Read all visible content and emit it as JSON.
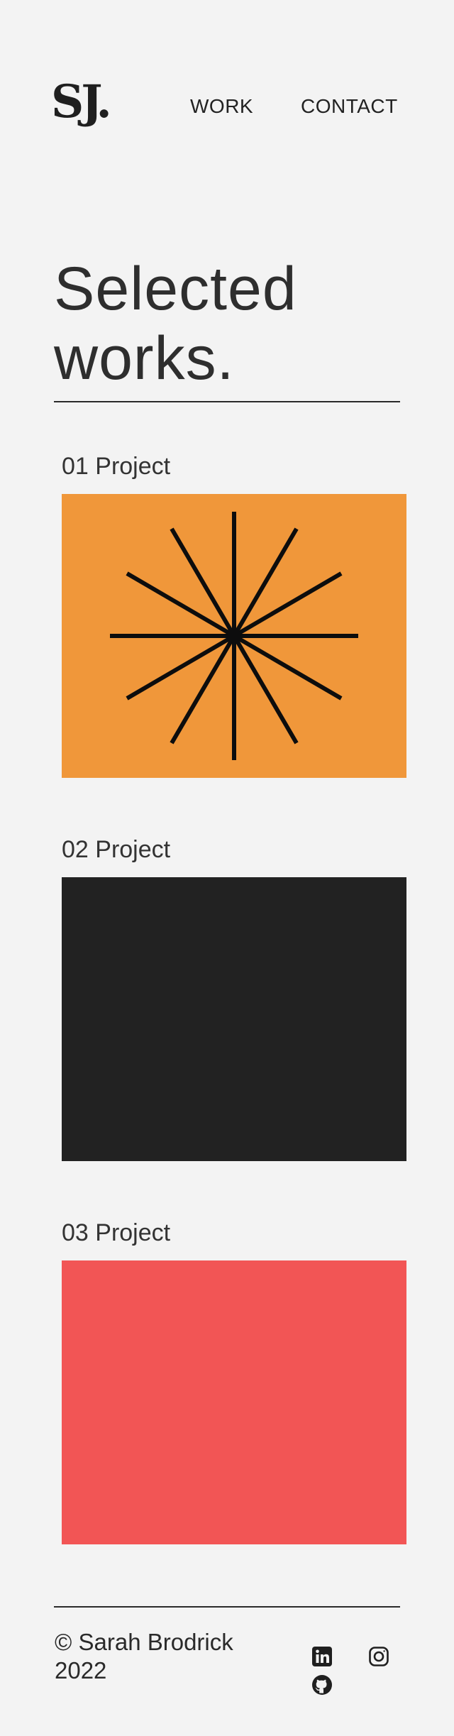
{
  "header": {
    "logo": "SJ.",
    "nav": [
      {
        "label": "WORK"
      },
      {
        "label": "CONTACT"
      }
    ]
  },
  "main": {
    "title_line1": "Selected",
    "title_line2": "works.",
    "projects": [
      {
        "label": "01 Project",
        "color": "#f0973a",
        "icon": "asterisk-burst-graphic"
      },
      {
        "label": "02 Project",
        "color": "#222222"
      },
      {
        "label": "03 Project",
        "color": "#f25555"
      }
    ]
  },
  "footer": {
    "copyright": "© Sarah Brodrick 2022",
    "social": [
      {
        "icon": "linkedin-icon"
      },
      {
        "icon": "instagram-icon"
      },
      {
        "icon": "github-icon"
      }
    ]
  }
}
